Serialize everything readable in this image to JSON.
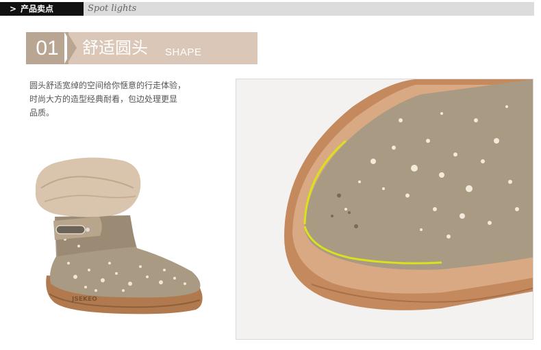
{
  "header": {
    "arrow": ">",
    "tag": "产品卖点",
    "subtitle": "Spot lights"
  },
  "banner": {
    "number": "01",
    "title": "舒适圆头",
    "title_en": "SHAPE"
  },
  "description": {
    "lines": [
      "圆头舒适宽绰的空间给你惬意的行走体验，",
      "时尚大方的造型经典耐看，包边处理更显",
      "品质。"
    ]
  },
  "boot": {
    "sole_brand": "JSEKEO"
  },
  "colors": {
    "banner_dark": "#b9a692",
    "banner_light": "#dac7b7",
    "suede": "#a99a84",
    "sole": "#b07a4e",
    "fur": "#d9c4ad",
    "highlight": "#d9e21a"
  }
}
